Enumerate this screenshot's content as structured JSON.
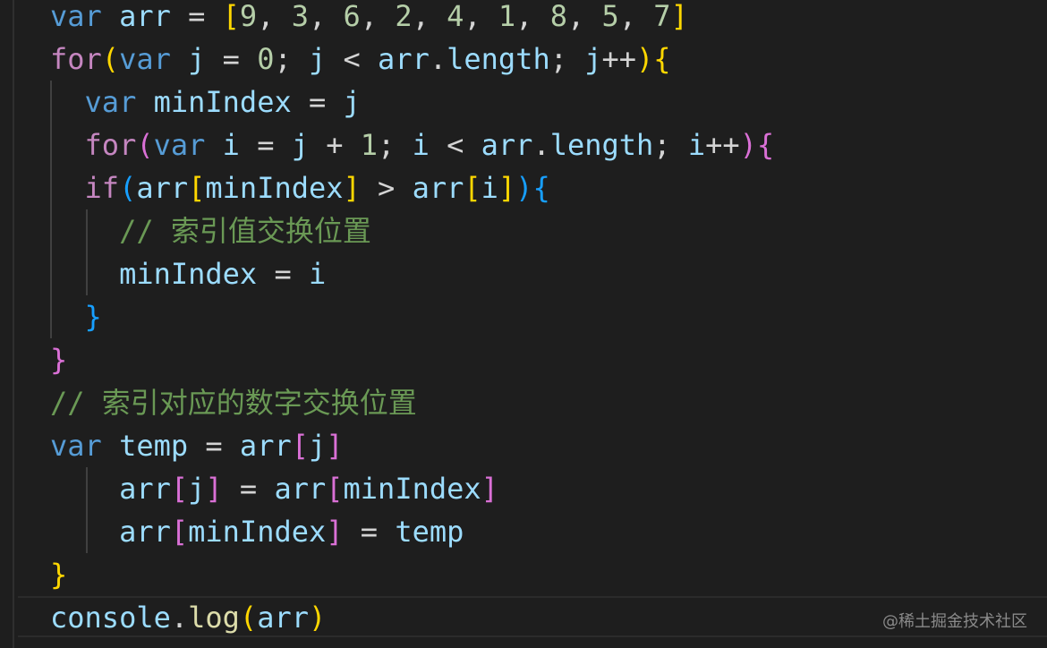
{
  "code": {
    "lines": [
      {
        "tokens": [
          {
            "t": "var",
            "c": "kw"
          },
          {
            "t": " ",
            "c": "op"
          },
          {
            "t": "arr",
            "c": "var"
          },
          {
            "t": " = ",
            "c": "op"
          },
          {
            "t": "[",
            "c": "b1"
          },
          {
            "t": "9",
            "c": "num"
          },
          {
            "t": ", ",
            "c": "op"
          },
          {
            "t": "3",
            "c": "num"
          },
          {
            "t": ", ",
            "c": "op"
          },
          {
            "t": "6",
            "c": "num"
          },
          {
            "t": ", ",
            "c": "op"
          },
          {
            "t": "2",
            "c": "num"
          },
          {
            "t": ", ",
            "c": "op"
          },
          {
            "t": "4",
            "c": "num"
          },
          {
            "t": ", ",
            "c": "op"
          },
          {
            "t": "1",
            "c": "num"
          },
          {
            "t": ", ",
            "c": "op"
          },
          {
            "t": "8",
            "c": "num"
          },
          {
            "t": ", ",
            "c": "op"
          },
          {
            "t": "5",
            "c": "num"
          },
          {
            "t": ", ",
            "c": "op"
          },
          {
            "t": "7",
            "c": "num"
          },
          {
            "t": "]",
            "c": "b1"
          }
        ]
      },
      {
        "tokens": [
          {
            "t": "for",
            "c": "ctl"
          },
          {
            "t": "(",
            "c": "b1"
          },
          {
            "t": "var",
            "c": "kw"
          },
          {
            "t": " ",
            "c": "op"
          },
          {
            "t": "j",
            "c": "var"
          },
          {
            "t": " = ",
            "c": "op"
          },
          {
            "t": "0",
            "c": "num"
          },
          {
            "t": "; ",
            "c": "op"
          },
          {
            "t": "j",
            "c": "var"
          },
          {
            "t": " < ",
            "c": "op"
          },
          {
            "t": "arr",
            "c": "var"
          },
          {
            "t": ".",
            "c": "op"
          },
          {
            "t": "length",
            "c": "var"
          },
          {
            "t": "; ",
            "c": "op"
          },
          {
            "t": "j",
            "c": "var"
          },
          {
            "t": "++",
            "c": "op"
          },
          {
            "t": ")",
            "c": "b1"
          },
          {
            "t": "{",
            "c": "b1"
          }
        ]
      },
      {
        "tokens": [
          {
            "t": "  ",
            "c": "op"
          },
          {
            "t": "var",
            "c": "kw"
          },
          {
            "t": " ",
            "c": "op"
          },
          {
            "t": "minIndex",
            "c": "var"
          },
          {
            "t": " = ",
            "c": "op"
          },
          {
            "t": "j",
            "c": "var"
          }
        ]
      },
      {
        "tokens": [
          {
            "t": "  ",
            "c": "op"
          },
          {
            "t": "for",
            "c": "ctl"
          },
          {
            "t": "(",
            "c": "b2"
          },
          {
            "t": "var",
            "c": "kw"
          },
          {
            "t": " ",
            "c": "op"
          },
          {
            "t": "i",
            "c": "var"
          },
          {
            "t": " = ",
            "c": "op"
          },
          {
            "t": "j",
            "c": "var"
          },
          {
            "t": " + ",
            "c": "op"
          },
          {
            "t": "1",
            "c": "num"
          },
          {
            "t": "; ",
            "c": "op"
          },
          {
            "t": "i",
            "c": "var"
          },
          {
            "t": " < ",
            "c": "op"
          },
          {
            "t": "arr",
            "c": "var"
          },
          {
            "t": ".",
            "c": "op"
          },
          {
            "t": "length",
            "c": "var"
          },
          {
            "t": "; ",
            "c": "op"
          },
          {
            "t": "i",
            "c": "var"
          },
          {
            "t": "++",
            "c": "op"
          },
          {
            "t": ")",
            "c": "b2"
          },
          {
            "t": "{",
            "c": "b2"
          }
        ]
      },
      {
        "tokens": [
          {
            "t": "  ",
            "c": "op"
          },
          {
            "t": "if",
            "c": "ctl"
          },
          {
            "t": "(",
            "c": "b3"
          },
          {
            "t": "arr",
            "c": "var"
          },
          {
            "t": "[",
            "c": "b1"
          },
          {
            "t": "minIndex",
            "c": "var"
          },
          {
            "t": "]",
            "c": "b1"
          },
          {
            "t": " > ",
            "c": "op"
          },
          {
            "t": "arr",
            "c": "var"
          },
          {
            "t": "[",
            "c": "b1"
          },
          {
            "t": "i",
            "c": "var"
          },
          {
            "t": "]",
            "c": "b1"
          },
          {
            "t": ")",
            "c": "b3"
          },
          {
            "t": "{",
            "c": "b3"
          }
        ]
      },
      {
        "tokens": [
          {
            "t": "    ",
            "c": "op"
          },
          {
            "t": "// 索引值交换位置",
            "c": "cmt"
          }
        ]
      },
      {
        "tokens": [
          {
            "t": "    ",
            "c": "op"
          },
          {
            "t": "minIndex",
            "c": "var"
          },
          {
            "t": " = ",
            "c": "op"
          },
          {
            "t": "i",
            "c": "var"
          }
        ]
      },
      {
        "tokens": [
          {
            "t": "  ",
            "c": "op"
          },
          {
            "t": "}",
            "c": "b3"
          }
        ]
      },
      {
        "tokens": [
          {
            "t": "}",
            "c": "b2"
          }
        ]
      },
      {
        "tokens": [
          {
            "t": "// 索引对应的数字交换位置",
            "c": "cmt"
          }
        ]
      },
      {
        "tokens": [
          {
            "t": "var",
            "c": "kw"
          },
          {
            "t": " ",
            "c": "op"
          },
          {
            "t": "temp",
            "c": "var"
          },
          {
            "t": " = ",
            "c": "op"
          },
          {
            "t": "arr",
            "c": "var"
          },
          {
            "t": "[",
            "c": "b2"
          },
          {
            "t": "j",
            "c": "var"
          },
          {
            "t": "]",
            "c": "b2"
          }
        ]
      },
      {
        "tokens": [
          {
            "t": "    ",
            "c": "op"
          },
          {
            "t": "arr",
            "c": "var"
          },
          {
            "t": "[",
            "c": "b2"
          },
          {
            "t": "j",
            "c": "var"
          },
          {
            "t": "]",
            "c": "b2"
          },
          {
            "t": " = ",
            "c": "op"
          },
          {
            "t": "arr",
            "c": "var"
          },
          {
            "t": "[",
            "c": "b2"
          },
          {
            "t": "minIndex",
            "c": "var"
          },
          {
            "t": "]",
            "c": "b2"
          }
        ]
      },
      {
        "tokens": [
          {
            "t": "    ",
            "c": "op"
          },
          {
            "t": "arr",
            "c": "var"
          },
          {
            "t": "[",
            "c": "b2"
          },
          {
            "t": "minIndex",
            "c": "var"
          },
          {
            "t": "]",
            "c": "b2"
          },
          {
            "t": " = ",
            "c": "op"
          },
          {
            "t": "temp",
            "c": "var"
          }
        ]
      },
      {
        "tokens": [
          {
            "t": "}",
            "c": "b1"
          }
        ]
      },
      {
        "tokens": [
          {
            "t": "console",
            "c": "var"
          },
          {
            "t": ".",
            "c": "op"
          },
          {
            "t": "log",
            "c": "fn"
          },
          {
            "t": "(",
            "c": "b1"
          },
          {
            "t": "arr",
            "c": "var"
          },
          {
            "t": ")",
            "c": "b1"
          }
        ]
      }
    ]
  },
  "watermark": "@稀土掘金技术社区",
  "colors": {
    "background": "#1e1e1e",
    "keyword": "#569cd6",
    "control": "#c586c0",
    "variable": "#9cdcfe",
    "function": "#dcdcaa",
    "number": "#b5cea8",
    "comment": "#6a9955",
    "bracket_level1": "#ffd700",
    "bracket_level2": "#da70d6",
    "bracket_level3": "#179fff"
  }
}
